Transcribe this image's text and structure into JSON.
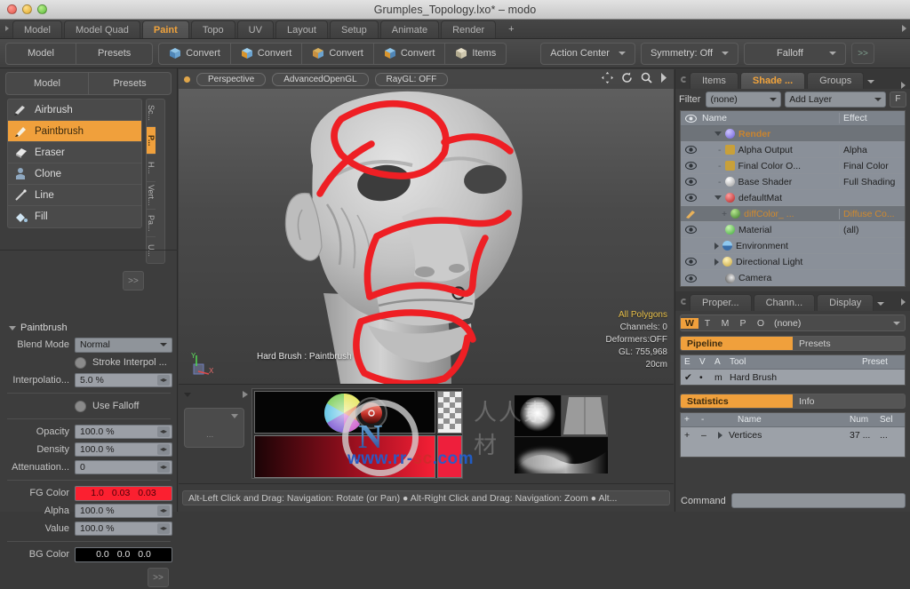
{
  "window": {
    "title": "Grumples_Topology.lxo* – modo",
    "traffic_lights": [
      "close",
      "minimize",
      "zoom"
    ]
  },
  "menubar": {
    "tabs": [
      {
        "label": "Model",
        "active": false
      },
      {
        "label": "Model Quad",
        "active": false
      },
      {
        "label": "Paint",
        "active": true
      },
      {
        "label": "Topo",
        "active": false
      },
      {
        "label": "UV",
        "active": false
      },
      {
        "label": "Layout",
        "active": false
      },
      {
        "label": "Setup",
        "active": false
      },
      {
        "label": "Animate",
        "active": false
      },
      {
        "label": "Render",
        "active": false
      },
      {
        "label": "+",
        "active": false
      }
    ]
  },
  "toolbar": {
    "mode_group": [
      {
        "label": "Model"
      },
      {
        "label": "Presets"
      }
    ],
    "convert_buttons": [
      {
        "label": "Convert"
      },
      {
        "label": "Convert"
      },
      {
        "label": "Convert"
      },
      {
        "label": "Convert"
      },
      {
        "label": "Items"
      }
    ],
    "action_center": "Action Center",
    "symmetry": "Symmetry: Off",
    "falloff": "Falloff",
    "more": ">>"
  },
  "left_panel": {
    "header_tabs": [
      {
        "label": "Model"
      },
      {
        "label": "Presets"
      }
    ],
    "tools": [
      {
        "label": "Airbrush",
        "icon": "airbrush-icon",
        "selected": false
      },
      {
        "label": "Paintbrush",
        "icon": "paintbrush-icon",
        "selected": true
      },
      {
        "label": "Eraser",
        "icon": "eraser-icon",
        "selected": false
      },
      {
        "label": "Clone",
        "icon": "clone-icon",
        "selected": false
      },
      {
        "label": "Line",
        "icon": "line-icon",
        "selected": false
      },
      {
        "label": "Fill",
        "icon": "fill-icon",
        "selected": false
      }
    ],
    "expand_button": ">>",
    "vertical_tabs": [
      {
        "label": "Sc...",
        "active": false
      },
      {
        "label": "P...",
        "active": true
      },
      {
        "label": "H...",
        "active": false
      },
      {
        "label": "Vert...",
        "active": false
      },
      {
        "label": "Pa...",
        "active": false
      },
      {
        "label": "U...",
        "active": false
      }
    ],
    "properties": {
      "section_title": "Paintbrush",
      "blend_mode_label": "Blend Mode",
      "blend_mode_value": "Normal",
      "stroke_interpol_label": "Stroke Interpol ...",
      "interpolation_label": "Interpolatio...",
      "interpolation_value": "5.0 %",
      "use_falloff_label": "Use Falloff",
      "opacity_label": "Opacity",
      "opacity_value": "100.0 %",
      "density_label": "Density",
      "density_value": "100.0 %",
      "attenuation_label": "Attenuation...",
      "attenuation_value": "0",
      "fg_color_label": "FG Color",
      "fg_color_value": [
        "1.0",
        "0.03",
        "0.03"
      ],
      "fg_color_hex": "#fb2030",
      "alpha_label": "Alpha",
      "alpha_value": "100.0 %",
      "value_label": "Value",
      "value_value": "100.0 %",
      "bg_color_label": "BG Color",
      "bg_color_value": [
        "0.0",
        "0.0",
        "0.0"
      ],
      "bg_color_hex": "#000000",
      "more_button": ">>"
    }
  },
  "viewport": {
    "view_mode": "Perspective",
    "shading_mode": "AdvancedOpenGL",
    "raygl": "RayGL: OFF",
    "nav_icons": [
      "pan-icon",
      "rotate-icon",
      "zoom-icon",
      "chevron-right-icon"
    ],
    "info": {
      "selection_mode": "All Polygons",
      "channels": "Channels: 0",
      "deformers": "Deformers:OFF",
      "gl": "GL: 755,968",
      "scale": "20cm"
    },
    "brush_status": "Hard Brush : Paintbrush",
    "axis_labels": [
      "Y",
      "X"
    ]
  },
  "bottom_panel": {
    "color_picker_name": "color-picker",
    "brush_preview_name": "brush-preview"
  },
  "right_panel": {
    "tabs": [
      {
        "label": "Items",
        "active": false
      },
      {
        "label": "Shade ...",
        "active": true
      },
      {
        "label": "Groups",
        "active": false
      }
    ],
    "filter_label": "Filter",
    "filter_value": "(none)",
    "add_layer": "Add Layer",
    "filter_button": "F",
    "shader_tree": {
      "columns": [
        "Name",
        "Effect"
      ],
      "rows": [
        {
          "name": "Render",
          "effect": "",
          "indent": 1,
          "eye": false,
          "arrow": "down",
          "orb": "#9a90e8",
          "highlight": "header",
          "orange": true
        },
        {
          "name": "Alpha Output",
          "effect": "Alpha",
          "indent": 2,
          "eye": true,
          "arrow": "dash",
          "orb": "#c8a03a"
        },
        {
          "name": "Final Color O...",
          "effect": "Final Color",
          "indent": 2,
          "eye": true,
          "arrow": "dash",
          "orb": "#c8a03a"
        },
        {
          "name": "Base Shader",
          "effect": "Full Shading",
          "indent": 2,
          "eye": true,
          "arrow": "dash",
          "orb": "#dcdcdc"
        },
        {
          "name": "defaultMat",
          "effect": "",
          "indent": 2,
          "eye": true,
          "arrow": "down",
          "orb": "#cc3b3b"
        },
        {
          "name": "diffColor_ ...",
          "effect": "Diffuse Co...",
          "indent": 3,
          "eye": false,
          "arrow": "plus",
          "orb": "#5ba84a",
          "selected": true,
          "orange": true
        },
        {
          "name": "Material",
          "effect": "(all)",
          "indent": 3,
          "eye": true,
          "arrow": "dash",
          "orb": "#5bc45a"
        },
        {
          "name": "Environment",
          "effect": "",
          "indent": 1,
          "eye": false,
          "arrow": "right",
          "orb": "#7aa8d8"
        },
        {
          "name": "Directional Light",
          "effect": "",
          "indent": 1,
          "eye": true,
          "arrow": "right",
          "orb": "#d8c86a"
        },
        {
          "name": "Camera",
          "effect": "",
          "indent": 1,
          "eye": true,
          "arrow": "none",
          "orb": "#9a9a9a"
        }
      ]
    },
    "lower_tabs": [
      {
        "label": "Proper...",
        "active": false
      },
      {
        "label": "Chann...",
        "active": false
      },
      {
        "label": "Display",
        "active": false
      }
    ],
    "wmpo": {
      "keys": [
        {
          "label": "W",
          "on": true
        },
        {
          "label": "T",
          "on": false
        },
        {
          "label": "M",
          "on": false
        },
        {
          "label": "P",
          "on": false
        },
        {
          "label": "O",
          "on": false
        }
      ],
      "value": "(none)"
    },
    "pipeline_tabs": [
      {
        "label": "Pipeline",
        "on": true
      },
      {
        "label": "Presets",
        "on": false
      }
    ],
    "tool_table": {
      "columns": [
        "E",
        "V",
        "A",
        "Tool",
        "Preset"
      ],
      "rows": [
        {
          "e": "✔",
          "v": "•",
          "a": "m",
          "tool": "Hard Brush",
          "preset": ""
        }
      ]
    },
    "stats_tabs": [
      {
        "label": "Statistics",
        "on": true
      },
      {
        "label": "Info",
        "on": false
      }
    ],
    "stats_table": {
      "columns": [
        "+",
        "-",
        "Name",
        "Num",
        "Sel"
      ],
      "rows": [
        {
          "plus": "+",
          "minus": "–",
          "name": "Vertices",
          "num": "37 ...",
          "sel": "..."
        }
      ]
    },
    "command_label": "Command",
    "command_value": ""
  },
  "statusbar": {
    "text": "Alt-Left Click and Drag: Navigation: Rotate (or Pan)  ●  Alt-Right Click and Drag: Navigation: Zoom  ●  Alt..."
  },
  "watermark": {
    "site": "www.rr-sc.com",
    "cn": "人人素材"
  },
  "colors": {
    "accent_orange": "#f0a03c",
    "paint_red": "#ee1f3c",
    "panel_bg": "#3d3d3d",
    "field_bg": "#9b9fa6"
  }
}
